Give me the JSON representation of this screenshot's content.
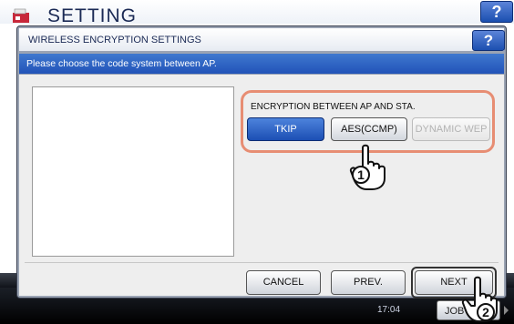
{
  "background": {
    "title": "SETTING",
    "help": "?",
    "clock": "17:04",
    "job_button": "JOB S"
  },
  "dialog": {
    "title": "WIRELESS ENCRYPTION SETTINGS",
    "help": "?",
    "message": "Please choose the code system between AP.",
    "section_label": "ENCRYPTION BETWEEN AP AND STA.",
    "encryption_options": [
      {
        "label": "TKIP",
        "state": "selected"
      },
      {
        "label": "AES(CCMP)",
        "state": "normal"
      },
      {
        "label": "DYNAMIC WEP",
        "state": "disabled"
      }
    ],
    "footer": {
      "cancel": "CANCEL",
      "prev": "PREV.",
      "next": "NEXT"
    }
  },
  "callouts": {
    "step1": "1",
    "step2": "2"
  },
  "colors": {
    "accent_blue": "#2253b8",
    "highlight": "#e78d73"
  },
  "icons": [
    "settings-app-icon",
    "hand-pointer-icon"
  ]
}
